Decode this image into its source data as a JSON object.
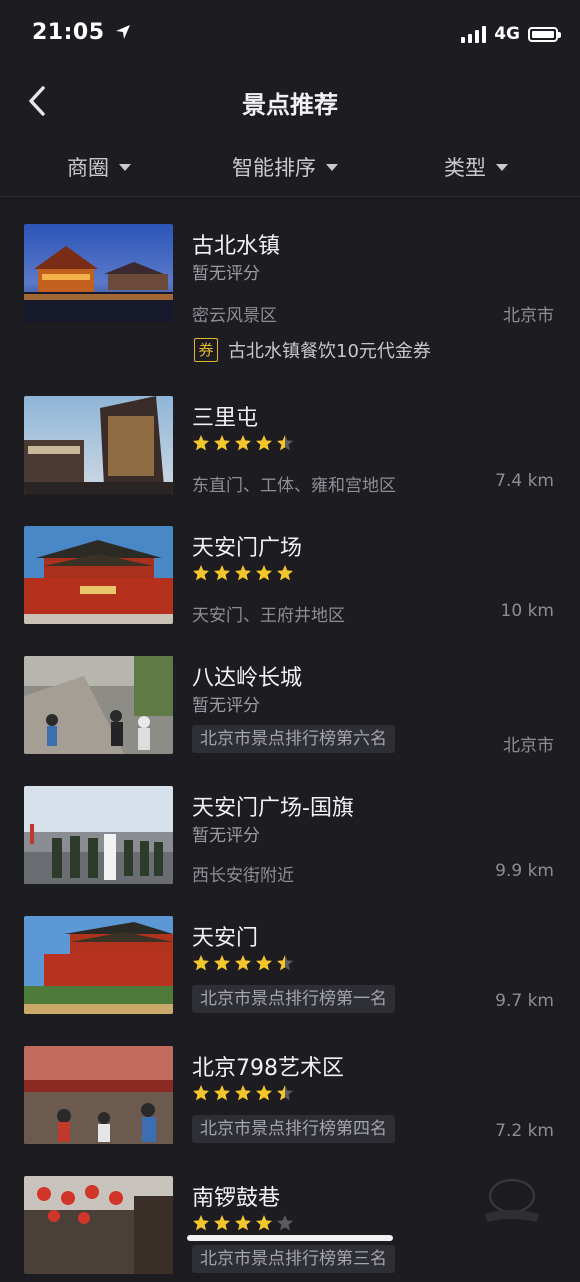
{
  "status_bar": {
    "time": "21:05",
    "network": "4G"
  },
  "nav": {
    "title": "景点推荐"
  },
  "filters": [
    "商圈",
    "智能排序",
    "类型"
  ],
  "coupon_badge": "券",
  "items": [
    {
      "name": "古北水镇",
      "rating_text": "暂无评分",
      "area": "密云风景区",
      "right": "北京市",
      "coupon": "古北水镇餐饮10元代金券"
    },
    {
      "name": "三里屯",
      "rating": 4.5,
      "area": "东直门、工体、雍和宫地区",
      "right": "7.4 km"
    },
    {
      "name": "天安门广场",
      "rating": 5,
      "area": "天安门、王府井地区",
      "right": "10 km"
    },
    {
      "name": "八达岭长城",
      "rating_text": "暂无评分",
      "tag": "北京市景点排行榜第六名",
      "right": "北京市"
    },
    {
      "name": "天安门广场-国旗",
      "rating_text": "暂无评分",
      "area": "西长安街附近",
      "right": "9.9 km"
    },
    {
      "name": "天安门",
      "rating": 4.5,
      "tag": "北京市景点排行榜第一名",
      "right": "9.7 km"
    },
    {
      "name": "北京798艺术区",
      "rating": 4.5,
      "tag": "北京市景点排行榜第四名",
      "right": "7.2 km"
    },
    {
      "name": "南锣鼓巷",
      "rating": 4,
      "tag": "北京市景点排行榜第三名",
      "right": ""
    }
  ],
  "colors": {
    "star": "#f5c62c",
    "star_empty": "#5a5a62",
    "background": "#1c1c21",
    "coupon": "#e2b631"
  },
  "icons": {
    "back": "chevron-left-icon",
    "location": "location-arrow-icon",
    "signal": "signal-icon",
    "battery": "battery-icon"
  }
}
